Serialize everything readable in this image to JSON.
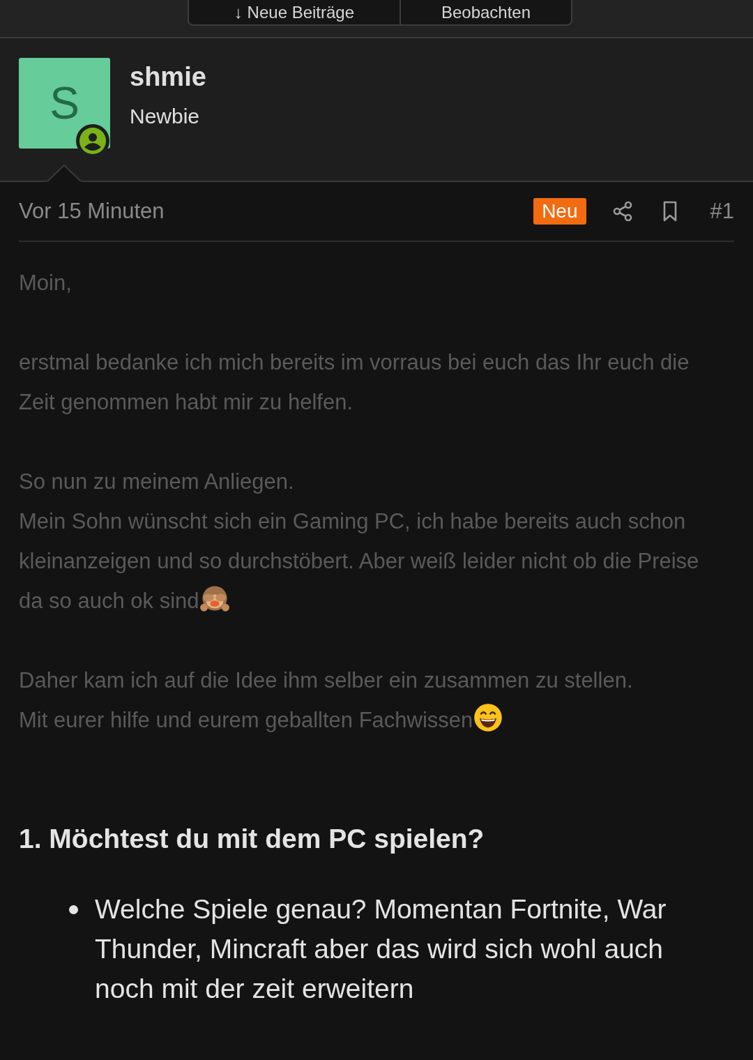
{
  "thread_actions": [
    {
      "label": "↓ Neue Beiträge"
    },
    {
      "label": "Beobachten"
    }
  ],
  "author": {
    "initial": "S",
    "name": "shmie",
    "rank": "Newbie",
    "online": true
  },
  "post": {
    "time": "Vor 15 Minuten",
    "badge": "Neu",
    "number": "#1",
    "paragraphs": [
      {
        "lines": [
          {
            "kind": "plain",
            "text": "Moin,"
          }
        ]
      },
      {
        "lines": [
          {
            "kind": "plain",
            "text": "erstmal bedanke ich mich bereits im vorraus bei euch das Ihr euch die Zeit genommen habt mir zu helfen."
          }
        ]
      },
      {
        "lines": [
          {
            "kind": "plain",
            "text": "So nun zu meinem Anliegen."
          },
          {
            "kind": "monkey",
            "text": "Mein Sohn wünscht sich ein Gaming PC, ich habe bereits auch schon kleinanzeigen und so durchstöbert. Aber weiß leider nicht ob die Preise da so auch ok sind"
          }
        ]
      },
      {
        "lines": [
          {
            "kind": "plain",
            "text": "Daher kam ich auf die Idee ihm selber ein zusammen zu stellen."
          },
          {
            "kind": "grin",
            "text": "Mit eurer hilfe und eurem geballten Fachwissen"
          }
        ]
      }
    ],
    "heading": "1. Möchtest du mit dem PC spielen?",
    "bullets": [
      "Welche Spiele genau? Momentan Fortnite, War Thunder, Mincraft aber das wird sich wohl auch noch mit der zeit erweitern"
    ]
  }
}
